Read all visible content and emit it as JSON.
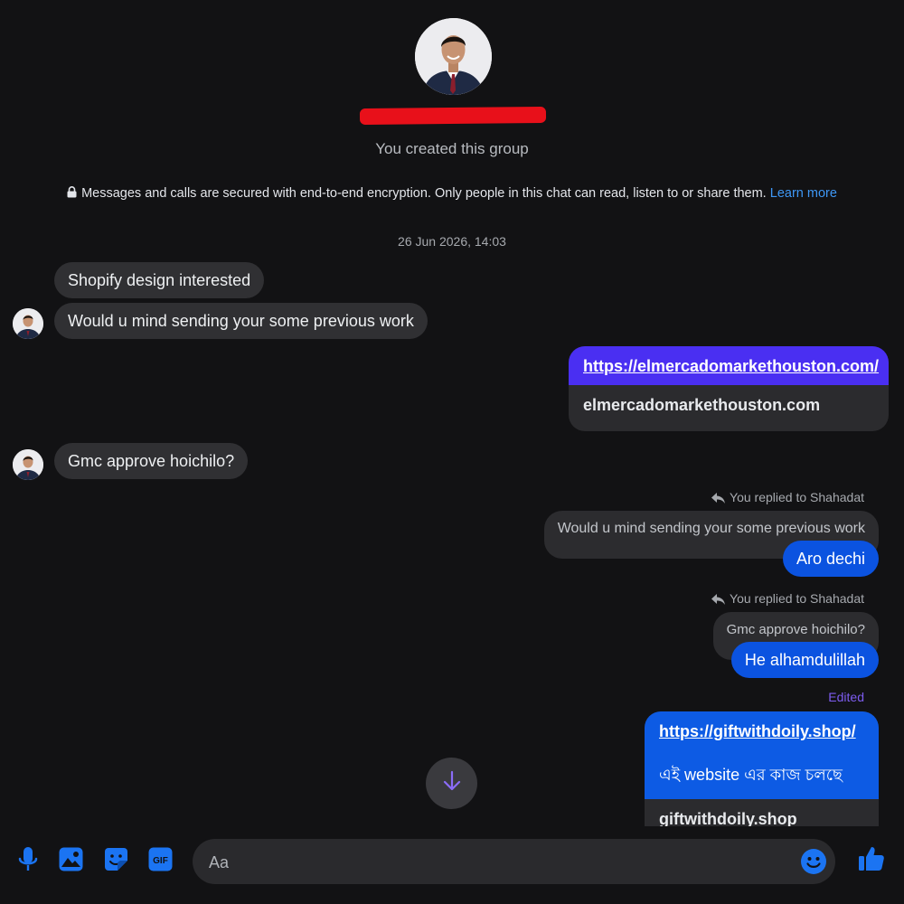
{
  "header": {
    "group_name_redacted": "",
    "created_text": "You created this group",
    "encryption_text": "Messages and calls are secured with end-to-end encryption. Only people in this chat can read, listen to or share them.",
    "learn_more": "Learn more"
  },
  "timestamp": "26 Jun 2026, 14:03",
  "messages": {
    "m1": "Shopify design interested",
    "m2": "Would u mind sending your some previous work",
    "link1": {
      "url": "https://elmercadomarkethouston.com/",
      "domain": "elmercadomarkethouston.com"
    },
    "m3": "Gmc approve hoichilo?",
    "reply1": {
      "label": "You replied to Shahadat",
      "quote": "Would u mind sending your some previous work",
      "text": "Aro dechi"
    },
    "reply2": {
      "label": "You replied to Shahadat",
      "quote": "Gmc approve hoichilo?",
      "text": "He alhamdulillah"
    },
    "edited_label": "Edited",
    "link2": {
      "url": "https://giftwithdoily.shop/",
      "text": "এই website এর কাজ চলছে",
      "domain": "giftwithdoily.shop"
    }
  },
  "composer": {
    "placeholder": "Aa"
  },
  "icons": {
    "mic": "microphone-icon",
    "image": "image-icon",
    "sticker": "sticker-icon",
    "gif": "gif-icon",
    "emoji": "emoji-icon",
    "like": "thumbs-up-icon",
    "scroll": "arrow-down-icon"
  },
  "colors": {
    "background": "#121214",
    "incoming_bubble": "#303033",
    "outgoing_bubble": "#0b53e0",
    "link_preview_header": "#4a2ff2",
    "accent": "#0a7cff",
    "redaction": "#e8101a"
  }
}
